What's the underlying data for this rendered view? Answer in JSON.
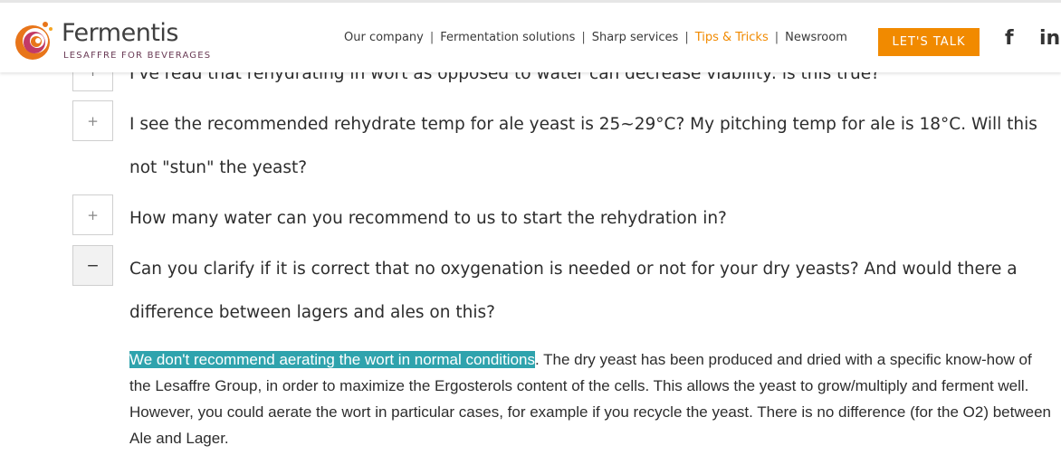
{
  "header": {
    "brand_name": "Fermentis",
    "brand_tagline": "LESAFFRE FOR BEVERAGES",
    "nav": [
      {
        "label": "Our company",
        "active": false
      },
      {
        "label": "Fermentation solutions",
        "active": false
      },
      {
        "label": "Sharp services",
        "active": false
      },
      {
        "label": "Tips & Tricks",
        "active": true
      },
      {
        "label": "Newsroom",
        "active": false
      }
    ],
    "nav_separator": "|",
    "cta_label": "LET'S TALK",
    "social": {
      "facebook_glyph": "f",
      "linkedin_glyph": "in"
    },
    "colors": {
      "accent": "#f18a00",
      "highlight": "#2fa3ad"
    }
  },
  "faq": {
    "items": [
      {
        "toggle": "+",
        "question": "I've read that rehydrating in wort as opposed to water can decrease viability: is this true?",
        "expanded": false
      },
      {
        "toggle": "+",
        "question": "I see the recommended rehydrate temp for ale yeast is 25~29°C? My pitching temp for ale is 18°C. Will this not \"stun\" the yeast?",
        "expanded": false
      },
      {
        "toggle": "+",
        "question": "How many water can you recommend to us to start the rehydration in?",
        "expanded": false
      },
      {
        "toggle": "−",
        "question": "Can you clarify if it is correct that no oxygenation is needed or not for your dry yeasts? And would there a difference between lagers and ales on this?",
        "expanded": true
      }
    ],
    "answer": {
      "highlighted": "We don't recommend aerating the wort in normal conditions",
      "rest": ". The dry yeast has been produced and dried with a specific know-how of the Lesaffre Group, in order to maximize the Ergosterols content of the cells. This allows the yeast to grow/multiply and ferment well.",
      "para2": "However, you could aerate the wort in particular cases, for example if you recycle the yeast. There is no difference (for the O2) between Ale and Lager."
    }
  }
}
